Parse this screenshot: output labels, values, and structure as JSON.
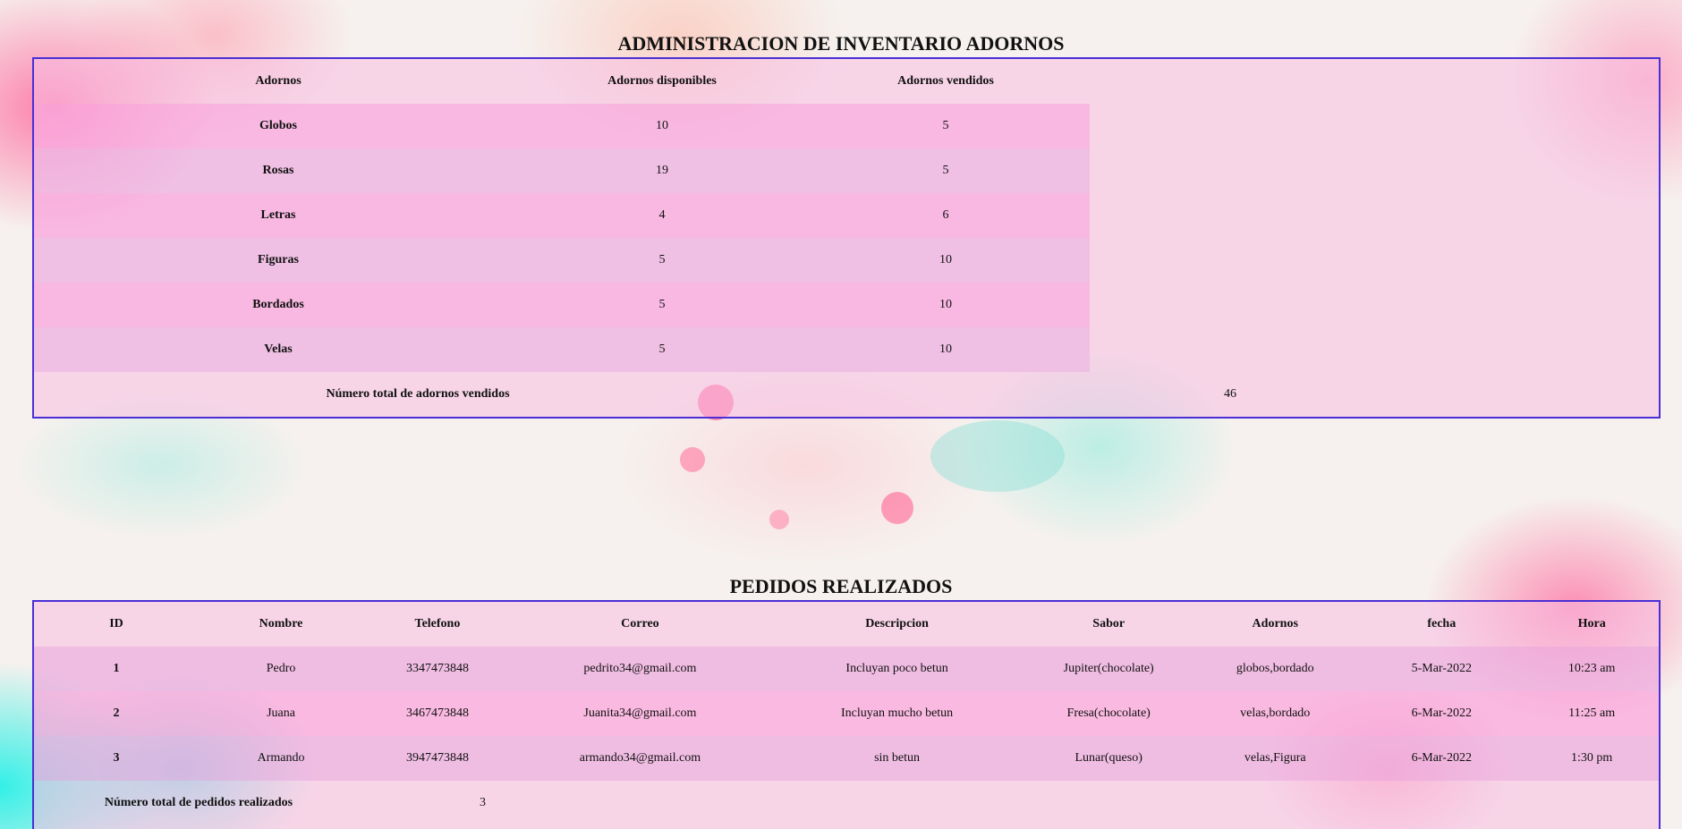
{
  "inventory": {
    "title": "ADMINISTRACION DE INVENTARIO ADORNOS",
    "headers": [
      "Adornos",
      "Adornos disponibles",
      "Adornos vendidos"
    ],
    "rows": [
      {
        "name": "Globos",
        "available": "10",
        "sold": "5"
      },
      {
        "name": "Rosas",
        "available": "19",
        "sold": "5"
      },
      {
        "name": "Letras",
        "available": "4",
        "sold": "6"
      },
      {
        "name": "Figuras",
        "available": "5",
        "sold": "10"
      },
      {
        "name": "Bordados",
        "available": "5",
        "sold": "10"
      },
      {
        "name": "Velas",
        "available": "5",
        "sold": "10"
      }
    ],
    "total_label": "Número total de adornos vendidos",
    "total_value": "46"
  },
  "orders": {
    "title": "PEDIDOS REALIZADOS",
    "headers": [
      "ID",
      "Nombre",
      "Telefono",
      "Correo",
      "Descripcion",
      "Sabor",
      "Adornos",
      "fecha",
      "Hora"
    ],
    "rows": [
      {
        "id": "1",
        "name": "Pedro",
        "phone": "3347473848",
        "email": "pedrito34@gmail.com",
        "description": "Incluyan poco betun",
        "flavor": "Jupiter(chocolate)",
        "decorations": "globos,bordado",
        "date": "5-Mar-2022",
        "time": "10:23 am"
      },
      {
        "id": "2",
        "name": "Juana",
        "phone": "3467473848",
        "email": "Juanita34@gmail.com",
        "description": "Incluyan mucho betun",
        "flavor": "Fresa(chocolate)",
        "decorations": "velas,bordado",
        "date": "6-Mar-2022",
        "time": "11:25 am"
      },
      {
        "id": "3",
        "name": "Armando",
        "phone": "3947473848",
        "email": "armando34@gmail.com",
        "description": "sin betun",
        "flavor": "Lunar(queso)",
        "decorations": "velas,Figura",
        "date": "6-Mar-2022",
        "time": "1:30 pm"
      }
    ],
    "total_label": "Número total de pedidos realizados",
    "total_value": "3"
  }
}
